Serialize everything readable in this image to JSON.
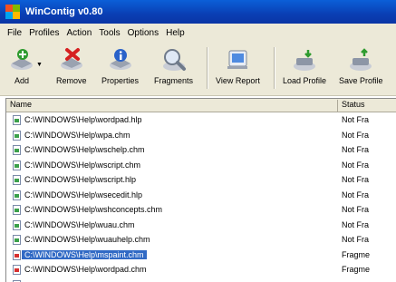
{
  "window": {
    "title": "WinContig v0.80"
  },
  "menu": [
    "File",
    "Profiles",
    "Action",
    "Tools",
    "Options",
    "Help"
  ],
  "toolbar": {
    "add": "Add",
    "remove": "Remove",
    "properties": "Properties",
    "fragments": "Fragments",
    "view_report": "View Report",
    "load_profile": "Load Profile",
    "save_profile": "Save Profile"
  },
  "list": {
    "columns": {
      "name": "Name",
      "status": "Status"
    },
    "rows": [
      {
        "name": "C:\\WINDOWS\\Help\\wordpad.hlp",
        "status": "Not Fra",
        "icon": "help-file-icon",
        "selected": false
      },
      {
        "name": "C:\\WINDOWS\\Help\\wpa.chm",
        "status": "Not Fra",
        "icon": "help-file-icon",
        "selected": false
      },
      {
        "name": "C:\\WINDOWS\\Help\\wschelp.chm",
        "status": "Not Fra",
        "icon": "help-file-icon",
        "selected": false
      },
      {
        "name": "C:\\WINDOWS\\Help\\wscript.chm",
        "status": "Not Fra",
        "icon": "help-file-icon",
        "selected": false
      },
      {
        "name": "C:\\WINDOWS\\Help\\wscript.hlp",
        "status": "Not Fra",
        "icon": "help-file-icon",
        "selected": false
      },
      {
        "name": "C:\\WINDOWS\\Help\\wsecedit.hlp",
        "status": "Not Fra",
        "icon": "help-file-icon",
        "selected": false
      },
      {
        "name": "C:\\WINDOWS\\Help\\wshconcepts.chm",
        "status": "Not Fra",
        "icon": "help-file-icon",
        "selected": false
      },
      {
        "name": "C:\\WINDOWS\\Help\\wuau.chm",
        "status": "Not Fra",
        "icon": "help-file-icon",
        "selected": false
      },
      {
        "name": "C:\\WINDOWS\\Help\\wuauhelp.chm",
        "status": "Not Fra",
        "icon": "help-file-icon",
        "selected": false
      },
      {
        "name": "C:\\WINDOWS\\Help\\mspaint.chm",
        "status": "Fragme",
        "icon": "fragmented-file-icon",
        "selected": true
      },
      {
        "name": "C:\\WINDOWS\\Help\\wordpad.chm",
        "status": "Fragme",
        "icon": "fragmented-file-icon",
        "selected": false
      },
      {
        "name": "",
        "status": "",
        "icon": "help-file-icon",
        "selected": false
      }
    ]
  }
}
